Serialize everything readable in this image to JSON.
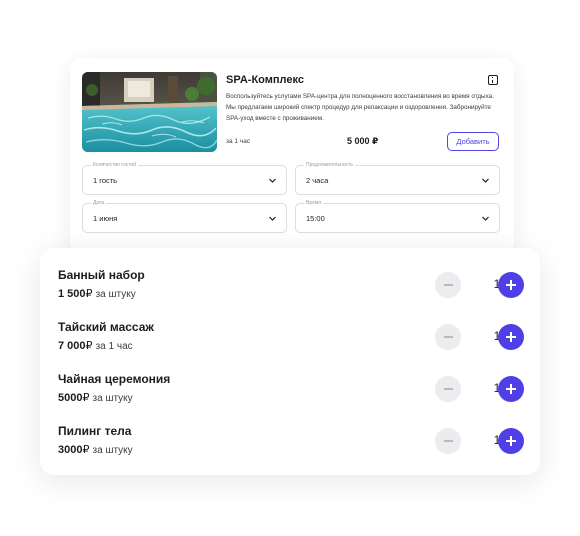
{
  "spa_card": {
    "title": "SPA-Комплекс",
    "description": "Воспользуйтесь услугами SPA-центра для полноценного восстановления во время отдыха. Мы предлагаем широкий спектр процедур для релаксации и оздоровления. Забронируйте SPA-уход вместе с проживанием.",
    "price_per": "за 1 час",
    "price": "5 000 ₽",
    "add_label": "Добавить",
    "icons": {
      "info": "info-icon",
      "chevron": "chevron-down-icon"
    },
    "fields": {
      "guests": {
        "label": "Количество гостей",
        "value": "1 гость"
      },
      "duration": {
        "label": "Продолжительность",
        "value": "2 часа"
      },
      "date": {
        "label": "Дата",
        "value": "1 июня"
      },
      "time": {
        "label": "Время",
        "value": "15:00"
      }
    }
  },
  "extras": [
    {
      "name": "Банный набор",
      "price": "1 500",
      "currency": "₽",
      "unit": "за штуку",
      "qty": "1"
    },
    {
      "name": "Тайский массаж",
      "price": "7 000",
      "currency": "₽",
      "unit": "за 1 час",
      "qty": "1"
    },
    {
      "name": "Чайная церемония",
      "price": "5000",
      "currency": "₽",
      "unit": "за штуку",
      "qty": "1"
    },
    {
      "name": "Пилинг тела",
      "price": "3000",
      "currency": "₽",
      "unit": "за штуку",
      "qty": "1"
    }
  ],
  "colors": {
    "accent": "#4f3fe6",
    "minus_bg": "#ececef",
    "border": "#dcdce3"
  }
}
